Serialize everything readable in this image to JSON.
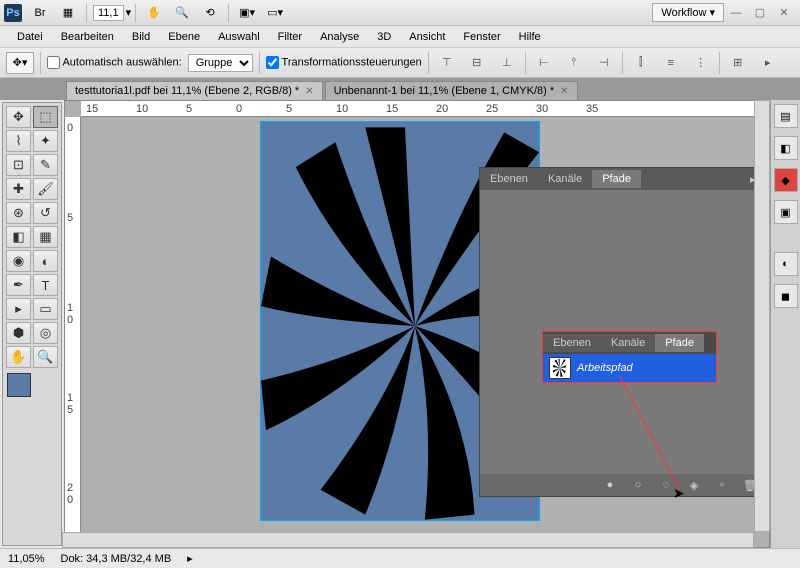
{
  "titlebar": {
    "zoom": "11,1",
    "workflow": "Workflow ▾"
  },
  "menu": [
    "Datei",
    "Bearbeiten",
    "Bild",
    "Ebene",
    "Auswahl",
    "Filter",
    "Analyse",
    "3D",
    "Ansicht",
    "Fenster",
    "Hilfe"
  ],
  "options": {
    "auto_select": "Automatisch auswählen:",
    "group": "Gruppe",
    "transform": "Transformationssteuerungen"
  },
  "tabs": [
    {
      "label": "testtutoria1l.pdf bei 11,1% (Ebene 2, RGB/8) *",
      "active": false
    },
    {
      "label": "Unbenannt-1 bei 11,1% (Ebene 1, CMYK/8) *",
      "active": true
    }
  ],
  "ruler_h": [
    "15",
    "10",
    "5",
    "0",
    "5",
    "10",
    "15",
    "20",
    "25",
    "30",
    "35"
  ],
  "ruler_v": [
    "0",
    "5",
    "1\n0",
    "1\n5",
    "2\n0"
  ],
  "panel": {
    "tabs": [
      "Ebenen",
      "Kanäle",
      "Pfade"
    ],
    "active": "Pfade",
    "path_name": "Arbeitspfad"
  },
  "status": {
    "zoom": "11,05%",
    "doc": "Dok: 34,3 MB/32,4 MB"
  },
  "colors": {
    "swatch": "#5a7aa8",
    "highlight": "#f33",
    "selection": "#2060e0"
  }
}
